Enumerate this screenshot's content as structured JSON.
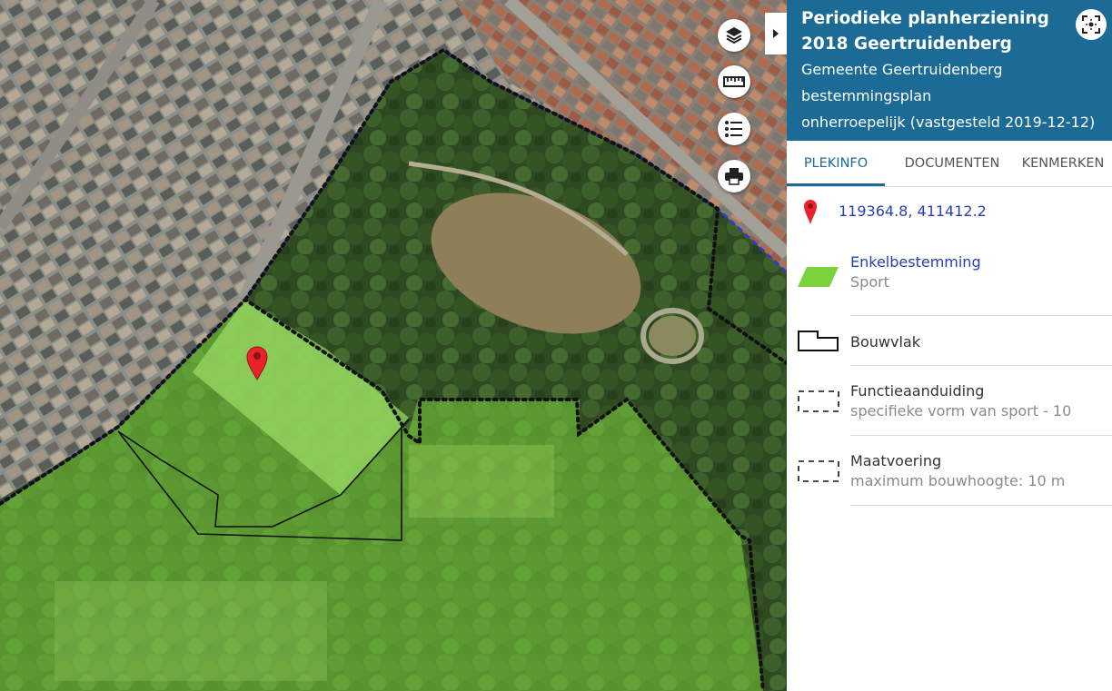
{
  "panel": {
    "title": "Periodieke planherziening 2018 Geertruidenberg",
    "municipality": "Gemeente Geertruidenberg",
    "plan_type": "bestemmingsplan",
    "status": "onherroepelijk (vastgesteld 2019-12-12)"
  },
  "tabs": [
    {
      "label": "PLEKINFO",
      "active": true
    },
    {
      "label": "DOCUMENTEN",
      "active": false
    },
    {
      "label": "KENMERKEN",
      "active": false
    }
  ],
  "location": {
    "coordinates": "119364.8, 411412.2"
  },
  "legend": [
    {
      "title": "Enkelbestemming",
      "subtitle": "Sport",
      "icon": "green-parallelogram-icon"
    },
    {
      "title": "Bouwvlak",
      "subtitle": "",
      "icon": "building-outline-icon"
    },
    {
      "title": "Functieaanduiding",
      "subtitle": "specifieke vorm van sport - 10",
      "icon": "dashed-rectangle-icon"
    },
    {
      "title": "Maatvoering",
      "subtitle": "maximum bouwhoogte: 10 m",
      "icon": "dashed-rectangle-icon"
    }
  ],
  "map_controls": [
    "layers-icon",
    "ruler-icon",
    "legend-list-icon",
    "print-icon"
  ],
  "colors": {
    "header_bg": "#1b6b96",
    "sport_zone": "#7bd23c",
    "link": "#2a3db5",
    "marker": "#e8232a"
  }
}
